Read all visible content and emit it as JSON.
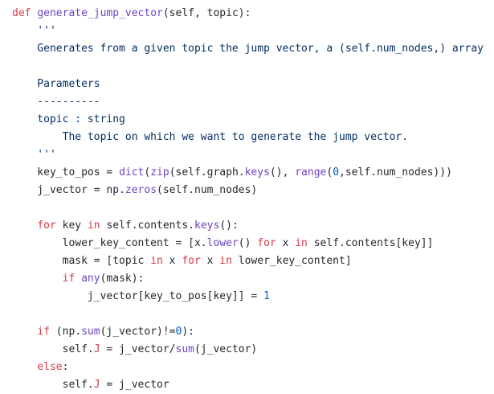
{
  "code_lines": [
    [
      {
        "t": "def ",
        "c": "kw"
      },
      {
        "t": "generate_jump_vector",
        "c": "fn"
      },
      {
        "t": "(self, topic):",
        "c": "pl"
      }
    ],
    [
      {
        "t": "    '''",
        "c": "str"
      }
    ],
    [
      {
        "t": "    Generates from a given topic the jump vector, a (self.num_nodes,) array",
        "c": "str"
      }
    ],
    [],
    [
      {
        "t": "    Parameters",
        "c": "str"
      }
    ],
    [
      {
        "t": "    ----------",
        "c": "str"
      }
    ],
    [
      {
        "t": "    topic : string",
        "c": "str"
      }
    ],
    [
      {
        "t": "        The topic on which we want to generate the jump vector.",
        "c": "str"
      }
    ],
    [
      {
        "t": "    '''",
        "c": "str"
      }
    ],
    [
      {
        "t": "    key_to_pos = ",
        "c": "pl"
      },
      {
        "t": "dict",
        "c": "fn"
      },
      {
        "t": "(",
        "c": "pl"
      },
      {
        "t": "zip",
        "c": "fn"
      },
      {
        "t": "(self.graph.",
        "c": "pl"
      },
      {
        "t": "keys",
        "c": "fn"
      },
      {
        "t": "(), ",
        "c": "pl"
      },
      {
        "t": "range",
        "c": "fn"
      },
      {
        "t": "(",
        "c": "pl"
      },
      {
        "t": "0",
        "c": "num"
      },
      {
        "t": ",self.num_nodes)))",
        "c": "pl"
      }
    ],
    [
      {
        "t": "    j_vector = np.",
        "c": "pl"
      },
      {
        "t": "zeros",
        "c": "fn"
      },
      {
        "t": "(self.num_nodes)",
        "c": "pl"
      }
    ],
    [],
    [
      {
        "t": "    ",
        "c": "pl"
      },
      {
        "t": "for",
        "c": "kw"
      },
      {
        "t": " key ",
        "c": "pl"
      },
      {
        "t": "in",
        "c": "kw"
      },
      {
        "t": " self.contents.",
        "c": "pl"
      },
      {
        "t": "keys",
        "c": "fn"
      },
      {
        "t": "():",
        "c": "pl"
      }
    ],
    [
      {
        "t": "        lower_key_content = [x.",
        "c": "pl"
      },
      {
        "t": "lower",
        "c": "fn"
      },
      {
        "t": "() ",
        "c": "pl"
      },
      {
        "t": "for",
        "c": "kw"
      },
      {
        "t": " x ",
        "c": "pl"
      },
      {
        "t": "in",
        "c": "kw"
      },
      {
        "t": " self.contents[key]]",
        "c": "pl"
      }
    ],
    [
      {
        "t": "        mask = [topic ",
        "c": "pl"
      },
      {
        "t": "in",
        "c": "kw"
      },
      {
        "t": " x ",
        "c": "pl"
      },
      {
        "t": "for",
        "c": "kw"
      },
      {
        "t": " x ",
        "c": "pl"
      },
      {
        "t": "in",
        "c": "kw"
      },
      {
        "t": " lower_key_content]",
        "c": "pl"
      }
    ],
    [
      {
        "t": "        ",
        "c": "pl"
      },
      {
        "t": "if",
        "c": "kw"
      },
      {
        "t": " ",
        "c": "pl"
      },
      {
        "t": "any",
        "c": "fn"
      },
      {
        "t": "(mask):",
        "c": "pl"
      }
    ],
    [
      {
        "t": "            j_vector[key_to_pos[key]] = ",
        "c": "pl"
      },
      {
        "t": "1",
        "c": "num"
      }
    ],
    [],
    [
      {
        "t": "    ",
        "c": "pl"
      },
      {
        "t": "if",
        "c": "kw"
      },
      {
        "t": " (np.",
        "c": "pl"
      },
      {
        "t": "sum",
        "c": "fn"
      },
      {
        "t": "(j_vector)!=",
        "c": "pl"
      },
      {
        "t": "0",
        "c": "num"
      },
      {
        "t": "):",
        "c": "pl"
      }
    ],
    [
      {
        "t": "        self.",
        "c": "pl"
      },
      {
        "t": "J",
        "c": "op"
      },
      {
        "t": " = j_vector/",
        "c": "pl"
      },
      {
        "t": "sum",
        "c": "fn"
      },
      {
        "t": "(j_vector)",
        "c": "pl"
      }
    ],
    [
      {
        "t": "    ",
        "c": "pl"
      },
      {
        "t": "else",
        "c": "kw"
      },
      {
        "t": ":",
        "c": "pl"
      }
    ],
    [
      {
        "t": "        self.",
        "c": "pl"
      },
      {
        "t": "J",
        "c": "op"
      },
      {
        "t": " = j_vector",
        "c": "pl"
      }
    ]
  ]
}
